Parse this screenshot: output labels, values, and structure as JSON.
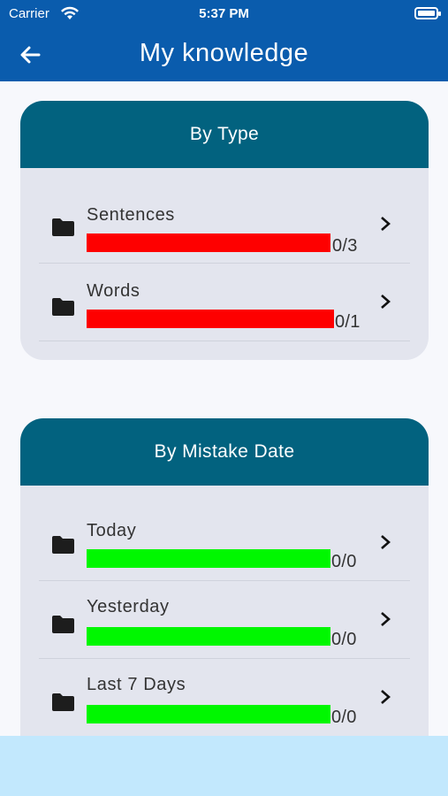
{
  "status_bar": {
    "carrier": "Carrier",
    "time": "5:37 PM"
  },
  "header": {
    "title": "My knowledge"
  },
  "by_type": {
    "title": "By Type",
    "items": [
      {
        "label": "Sentences",
        "count": "0/3",
        "bar_color": "#fe0000"
      },
      {
        "label": "Words",
        "count": "0/1",
        "bar_color": "#fe0000"
      }
    ]
  },
  "by_mistake_date": {
    "title": "By Mistake Date",
    "items": [
      {
        "label": "Today",
        "count": "0/0",
        "bar_color": "#00f700"
      },
      {
        "label": "Yesterday",
        "count": "0/0",
        "bar_color": "#00f700"
      },
      {
        "label": "Last 7 Days",
        "count": "0/0",
        "bar_color": "#00f700"
      }
    ]
  },
  "colors": {
    "appbar": "#0a5cad",
    "card_header": "#02627f",
    "card_body": "#e3e5ee"
  },
  "icons": {
    "back": "arrow-left-icon",
    "folder": "folder-icon",
    "chevron": "chevron-right-icon"
  }
}
